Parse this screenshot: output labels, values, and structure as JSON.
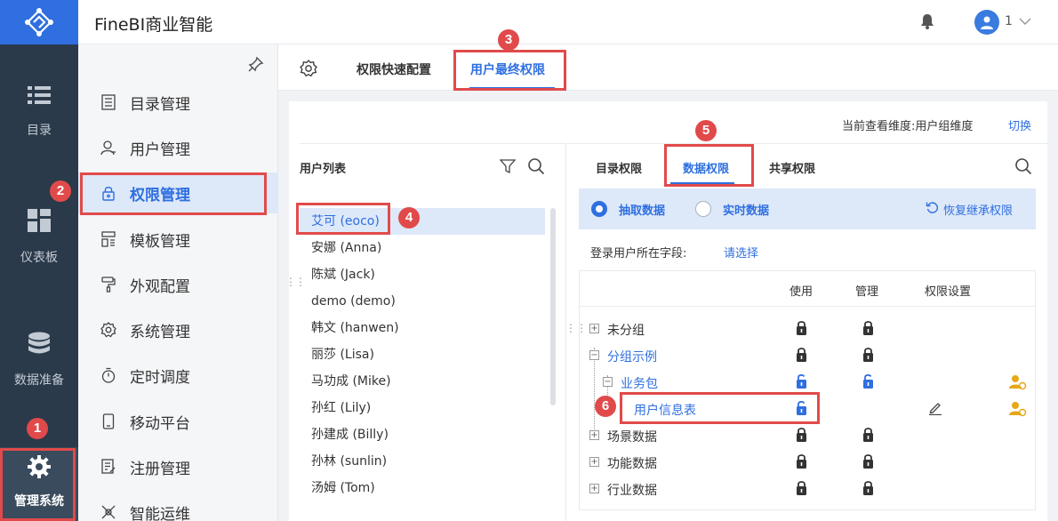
{
  "app": {
    "title": "FineBI商业智能"
  },
  "header": {
    "user_name": "1"
  },
  "rail": {
    "items": [
      {
        "label": "目录",
        "icon": "list-icon"
      },
      {
        "label": "仪表板",
        "icon": "dashboard-icon"
      },
      {
        "label": "数据准备",
        "icon": "database-icon"
      },
      {
        "label": "管理系统",
        "icon": "gear-icon"
      }
    ]
  },
  "nav": {
    "items": [
      {
        "label": "目录管理",
        "icon": "catalog-icon"
      },
      {
        "label": "用户管理",
        "icon": "user-icon"
      },
      {
        "label": "权限管理",
        "icon": "lock-icon"
      },
      {
        "label": "模板管理",
        "icon": "template-icon"
      },
      {
        "label": "外观配置",
        "icon": "paint-roller-icon"
      },
      {
        "label": "系统管理",
        "icon": "settings-icon"
      },
      {
        "label": "定时调度",
        "icon": "timer-icon"
      },
      {
        "label": "移动平台",
        "icon": "mobile-icon"
      },
      {
        "label": "注册管理",
        "icon": "register-icon"
      },
      {
        "label": "智能运维",
        "icon": "ops-icon"
      }
    ]
  },
  "tabs": {
    "quick_config": "权限快速配置",
    "final_permission": "用户最终权限"
  },
  "dimension": {
    "label": "当前查看维度:用户组维度",
    "switch": "切换"
  },
  "user_list": {
    "title": "用户列表",
    "users": [
      "艾可 (eoco)",
      "安娜 (Anna)",
      "陈斌 (Jack)",
      "demo (demo)",
      "韩文 (hanwen)",
      "丽莎 (Lisa)",
      "马功成 (Mike)",
      "孙红 (Lily)",
      "孙建成 (Billy)",
      "孙林 (sunlin)",
      "汤姆 (Tom)"
    ]
  },
  "perm_tabs": {
    "catalog": "目录权限",
    "data": "数据权限",
    "share": "共享权限"
  },
  "mode": {
    "extract": "抽取数据",
    "realtime": "实时数据",
    "restore": "恢复继承权限"
  },
  "field": {
    "label": "登录用户所在字段:",
    "placeholder": "请选择"
  },
  "table": {
    "headers": {
      "use": "使用",
      "manage": "管理",
      "settings": "权限设置"
    },
    "rows": [
      {
        "label": "未分组",
        "use": "locked",
        "manage": "locked"
      },
      {
        "label": "分组示例",
        "use": "locked",
        "manage": "locked"
      },
      {
        "label": "业务包",
        "use": "unlocked",
        "manage": "unlocked"
      },
      {
        "label": "用户信息表",
        "use": "unlocked",
        "manage": ""
      },
      {
        "label": "场景数据",
        "use": "locked",
        "manage": "locked"
      },
      {
        "label": "功能数据",
        "use": "locked",
        "manage": "locked"
      },
      {
        "label": "行业数据",
        "use": "locked",
        "manage": "locked"
      }
    ]
  },
  "annotations": [
    "1",
    "2",
    "3",
    "4",
    "5",
    "6"
  ],
  "colors": {
    "accent": "#2f6fe0",
    "rail": "#2b3a4a",
    "annotation": "#e14a4a",
    "lock_gray": "#333333"
  }
}
